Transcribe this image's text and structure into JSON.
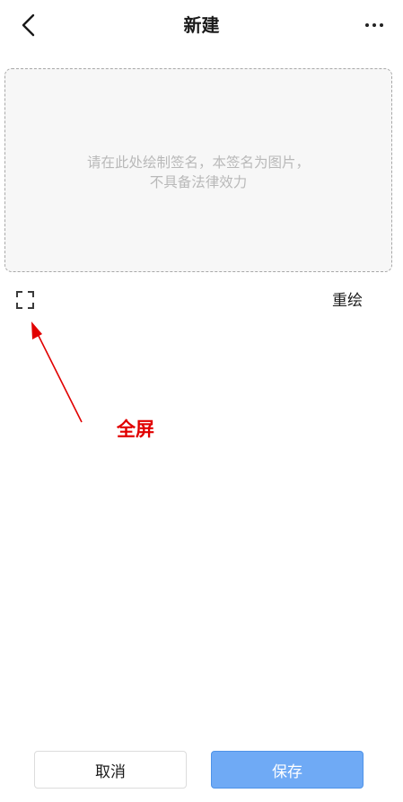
{
  "header": {
    "title": "新建",
    "back_icon": "chevron-left-icon",
    "more_icon": "more-horizontal-icon"
  },
  "signature_pad": {
    "placeholder": "请在此处绘制签名，本签名为图片，不具备法律效力"
  },
  "toolbar": {
    "fullscreen_icon": "fullscreen-icon",
    "redraw_label": "重绘"
  },
  "annotation": {
    "label": "全屏",
    "color": "#e10000"
  },
  "footer": {
    "cancel_label": "取消",
    "save_label": "保存"
  },
  "colors": {
    "primary": "#6faaf5",
    "primary_border": "#4f93e8"
  }
}
